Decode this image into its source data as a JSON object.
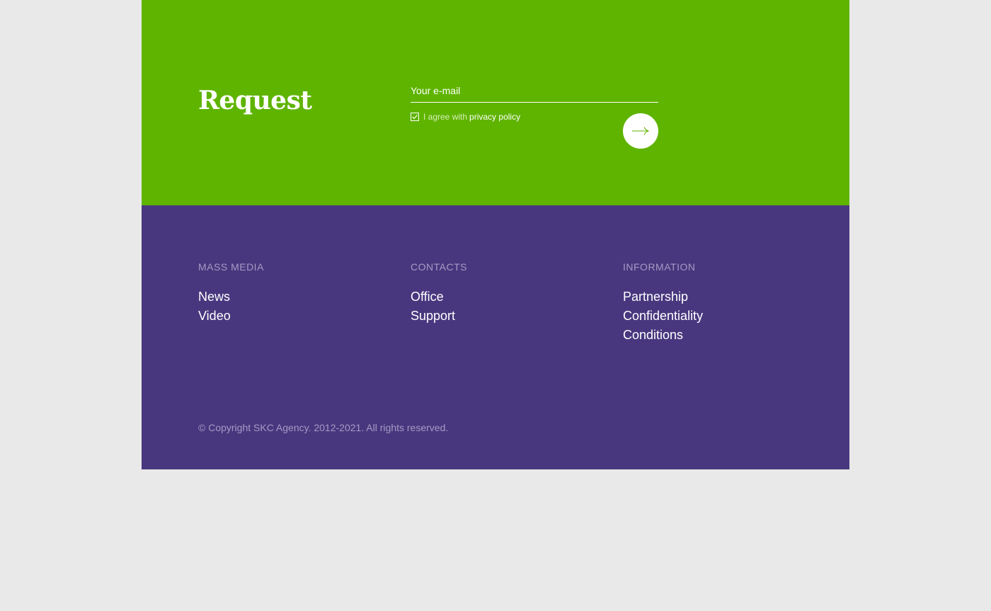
{
  "request": {
    "title": "Request",
    "email_placeholder": "Your e-mail",
    "agree_text": "I agree with",
    "privacy_link": "privacy policy",
    "submit_icon": "arrow-right-icon",
    "accent_color": "#5fb400"
  },
  "footer": {
    "background_color": "#48377e",
    "columns": [
      {
        "heading": "MASS MEDIA",
        "links": [
          "News",
          "Video"
        ]
      },
      {
        "heading": "CONTACTS",
        "links": [
          "Office",
          "Support"
        ]
      },
      {
        "heading": "INFORMATION",
        "links": [
          "Partnership",
          "Confidentiality",
          "Conditions"
        ]
      }
    ],
    "copyright": "© Copyright SKC Agency. 2012-2021. All rights reserved."
  }
}
